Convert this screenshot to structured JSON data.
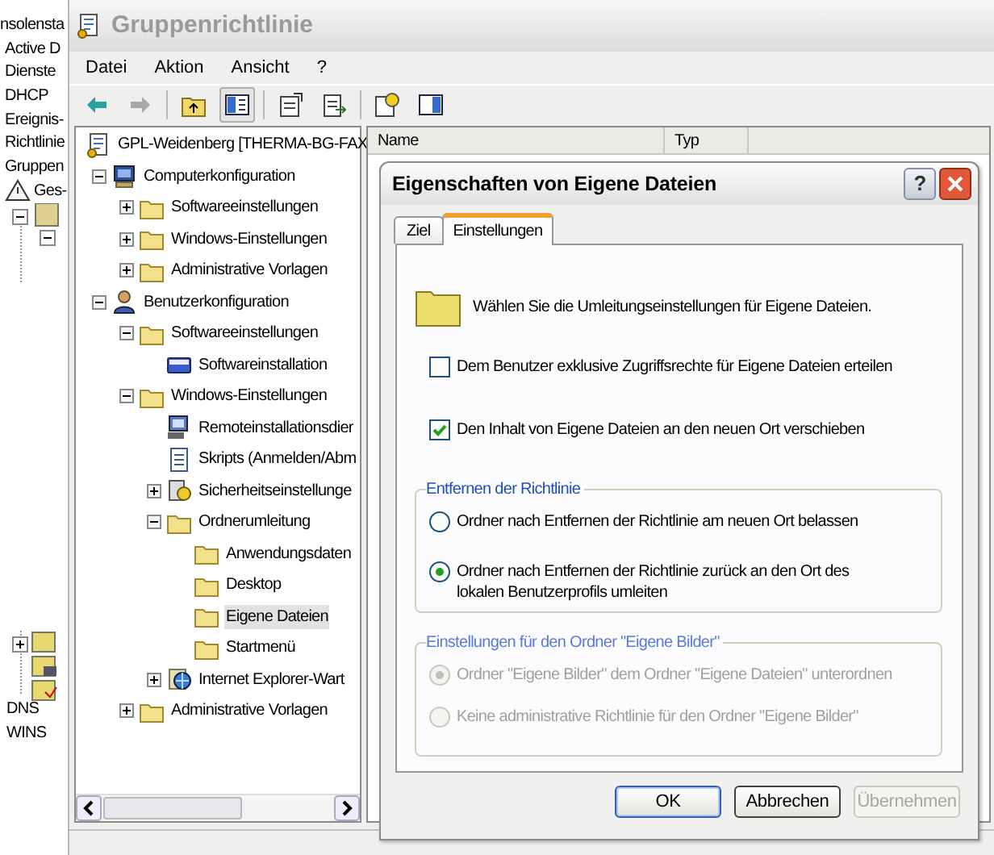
{
  "console": {
    "items": [
      {
        "label": "nsolensta"
      },
      {
        "label": "Active D"
      },
      {
        "label": "Dienste"
      },
      {
        "label": "DHCP"
      },
      {
        "label": "Ereignis-"
      },
      {
        "label": "Richtlinie"
      },
      {
        "label": "Gruppen"
      },
      {
        "label": "Ges-"
      }
    ],
    "lower_items": [
      {
        "label": "DNS"
      },
      {
        "label": "WINS"
      }
    ]
  },
  "main_window": {
    "title": "Gruppenrichtlinie",
    "menu": [
      "Datei",
      "Aktion",
      "Ansicht",
      "?"
    ],
    "tree": [
      {
        "label": "GPL-Weidenberg [THERMA-BG-FAX",
        "kind": "policy",
        "selected": false,
        "children": [
          {
            "label": "Computerkonfiguration",
            "kind": "computer",
            "expanded": true,
            "selected": false,
            "children": [
              {
                "label": "Softwareeinstellungen",
                "kind": "folder",
                "expanded": false,
                "selected": false
              },
              {
                "label": "Windows-Einstellungen",
                "kind": "folder",
                "expanded": false,
                "selected": false
              },
              {
                "label": "Administrative Vorlagen",
                "kind": "folder",
                "expanded": false,
                "selected": false
              }
            ]
          },
          {
            "label": "Benutzerkonfiguration",
            "kind": "user",
            "expanded": true,
            "selected": false,
            "children": [
              {
                "label": "Softwareeinstellungen",
                "kind": "folder",
                "expanded": true,
                "selected": false,
                "children": [
                  {
                    "label": "Softwareinstallation",
                    "kind": "install",
                    "selected": false
                  }
                ]
              },
              {
                "label": "Windows-Einstellungen",
                "kind": "folder",
                "expanded": true,
                "selected": false,
                "children": [
                  {
                    "label": "Remoteinstallationsdier",
                    "kind": "remote",
                    "selected": false
                  },
                  {
                    "label": "Skripts (Anmelden/Abm",
                    "kind": "script",
                    "selected": false
                  },
                  {
                    "label": "Sicherheitseinstellunge",
                    "kind": "security",
                    "expanded": false,
                    "selected": false
                  },
                  {
                    "label": "Ordnerumleitung",
                    "kind": "folder",
                    "expanded": true,
                    "selected": false,
                    "children": [
                      {
                        "label": "Anwendungsdaten",
                        "kind": "folder",
                        "selected": false
                      },
                      {
                        "label": "Desktop",
                        "kind": "folder",
                        "selected": false
                      },
                      {
                        "label": "Eigene Dateien",
                        "kind": "folder",
                        "selected": true
                      },
                      {
                        "label": "Startmenü",
                        "kind": "folder",
                        "selected": false
                      }
                    ]
                  },
                  {
                    "label": "Internet Explorer-Wart",
                    "kind": "ie",
                    "expanded": false,
                    "selected": false
                  }
                ]
              },
              {
                "label": "Administrative Vorlagen",
                "kind": "folder",
                "expanded": false,
                "selected": false
              }
            ]
          }
        ]
      }
    ],
    "columns": [
      "Name",
      "Typ"
    ]
  },
  "dialog": {
    "title": "Eigenschaften von Eigene Dateien",
    "help_button": "?",
    "tabs": [
      {
        "label": "Ziel",
        "selected": false
      },
      {
        "label": "Einstellungen",
        "selected": true
      }
    ],
    "intro": "Wählen Sie die Umleitungseinstellungen für Eigene Dateien.",
    "checkboxes": [
      {
        "label": "Dem Benutzer exklusive Zugriffsrechte für Eigene Dateien erteilen",
        "checked": false
      },
      {
        "label": "Den Inhalt von Eigene Dateien an den neuen Ort verschieben",
        "checked": true
      }
    ],
    "groups": [
      {
        "title": "Entfernen der Richtlinie",
        "disabled": false,
        "options": [
          {
            "label": "Ordner nach Entfernen der Richtlinie am neuen Ort belassen",
            "selected": false
          },
          {
            "label": "Ordner nach Entfernen der Richtlinie zurück an den Ort des lokalen Benutzerprofils umleiten",
            "selected": true
          }
        ]
      },
      {
        "title": "Einstellungen für den Ordner \"Eigene Bilder\"",
        "disabled": true,
        "options": [
          {
            "label": "Ordner \"Eigene Bilder\" dem Ordner \"Eigene Dateien\" unterordnen",
            "selected": true
          },
          {
            "label": "Keine administrative Richtlinie für den Ordner \"Eigene Bilder\"",
            "selected": false
          }
        ]
      }
    ],
    "buttons": [
      {
        "label": "OK",
        "default": true,
        "disabled": false
      },
      {
        "label": "Abbrechen",
        "default": false,
        "disabled": false
      },
      {
        "label": "Übernehmen",
        "default": false,
        "disabled": true
      }
    ]
  }
}
